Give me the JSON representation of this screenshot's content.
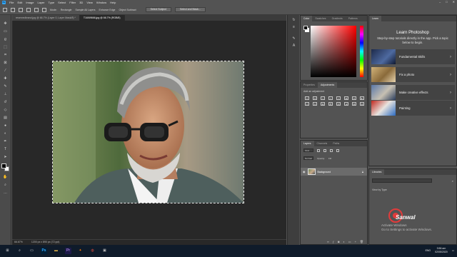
{
  "menubar": {
    "logo": "Ps",
    "items": [
      "File",
      "Edit",
      "Image",
      "Layer",
      "Type",
      "Select",
      "Filter",
      "3D",
      "View",
      "Window",
      "Help"
    ],
    "window_controls": [
      "–",
      "□",
      "✕"
    ]
  },
  "options": {
    "mode_label": "Mode:",
    "mode_value": "Rectangle",
    "sample_all": "Sample All Layers",
    "enhance_edge": "Enhance Edge",
    "object_subtract": "Object Subtract",
    "select_subject": "Select Subject",
    "select_mask": "Select and Mask..."
  },
  "tabs": [
    {
      "label": "reservedbrand.jpg @ 66.7% (Layer 0, Layer Mask/8) *",
      "active": false
    },
    {
      "label": "T16/69666.jpg @ 66.7% (RGB/8)",
      "active": true
    }
  ],
  "status": {
    "zoom": "66.67%",
    "doc": "1200 px x 890 px (72 ppi)"
  },
  "color_panel": {
    "tabs": [
      "Color",
      "Swatches",
      "Gradients",
      "Patterns"
    ],
    "accent_hue": "#ff0000"
  },
  "adjust_panel": {
    "tabs": [
      "Properties",
      "Adjustments"
    ],
    "label": "Add an adjustment",
    "icons": [
      "brightness",
      "levels",
      "curves",
      "exposure",
      "vibrance",
      "hue-sat",
      "color-balance",
      "bw",
      "photo-filter",
      "channel-mixer",
      "color-lookup",
      "invert",
      "posterize",
      "threshold",
      "selective-color",
      "gradient-map"
    ]
  },
  "layers_panel": {
    "tabs": [
      "Layers",
      "Channels",
      "Paths"
    ],
    "filter_kind": "Kind",
    "blend_mode": "Normal",
    "opacity_label": "Opacity:",
    "fill_label": "Fill:",
    "layer_name": "Background"
  },
  "learn_panel": {
    "tab": "Learn",
    "title": "Learn Photoshop",
    "description": "Step-by-step tutorials directly in the app. Pick a topic below to begin.",
    "cards": [
      "Fundamental Skills",
      "Fix a photo",
      "Make creative effects",
      "Painting"
    ]
  },
  "libraries_panel": {
    "tab": "Libraries",
    "view_by": "View by Type"
  },
  "watermark": {
    "name": "Sanwal",
    "activate_line1": "Activate Windows",
    "activate_line2": "Go to Settings to activate Windows."
  },
  "taskbar": {
    "start_icon": "windows-icon",
    "time": "3:56 am",
    "date": "02/05/2020",
    "lang": "ENG"
  }
}
